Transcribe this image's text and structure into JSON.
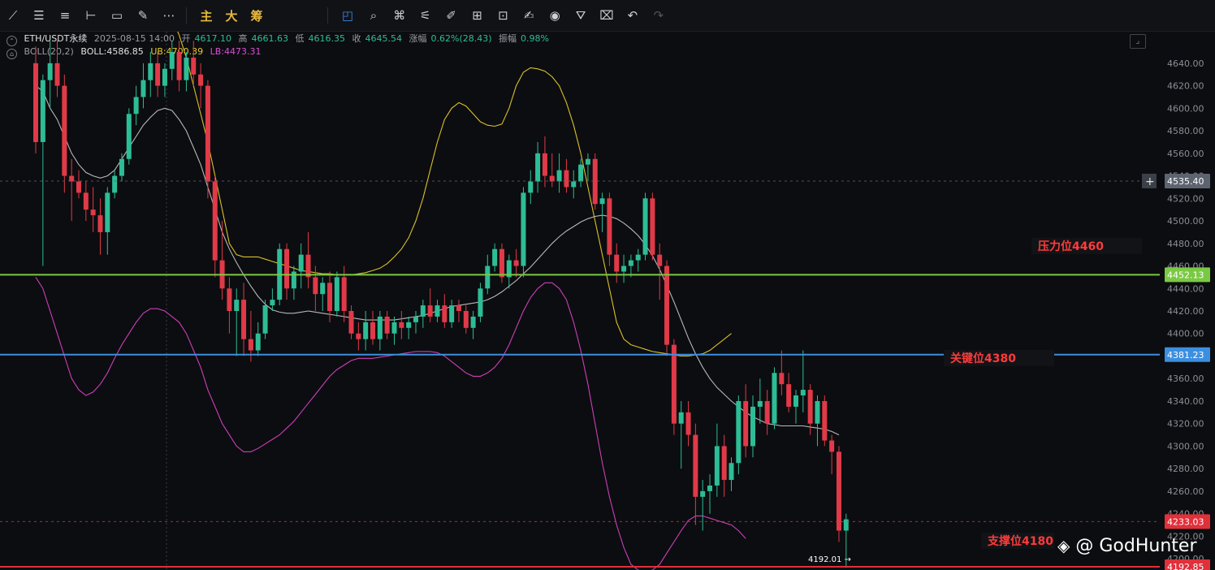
{
  "toolbar": {
    "tools": [
      "trend-line-icon",
      "horizontal-lines-icon",
      "parallel-lines-icon",
      "horizontal-ray-icon",
      "rectangle-icon",
      "brush-icon",
      "more-icon"
    ],
    "labels": [
      "主",
      "大",
      "筹"
    ],
    "right_tools": [
      "indicator-icon",
      "magic-icon",
      "shape-select-icon",
      "ruler-icon",
      "pencil-icon",
      "measure-icon",
      "lock-icon",
      "note-icon",
      "magnet-icon",
      "filter-icon",
      "trash-icon",
      "undo-icon",
      "redo-icon"
    ]
  },
  "info": {
    "symbol": "ETH/USDT永续",
    "time": "2025-08-15 14:00",
    "open_label": "开",
    "open": "4617.10",
    "high_label": "高",
    "high": "4661.63",
    "low_label": "低",
    "low": "4616.35",
    "close_label": "收",
    "close": "4645.54",
    "change_label": "涨幅",
    "change": "0.62%(28.43)",
    "amp_label": "振幅",
    "amp": "0.98%",
    "boll_name": "BOLL(20,2)",
    "boll": "BOLL:4586.85",
    "ub": "UB:4700.39",
    "lb": "LB:4473.31"
  },
  "annotations": {
    "resistance": "压力位4460",
    "key": "关键位4380",
    "support": "支撑位4180"
  },
  "watermark": "@ GodHunter",
  "chart_data": {
    "type": "candlestick",
    "symbol": "ETH/USDT永续",
    "y_ticks": [
      4640,
      4620,
      4600,
      4580,
      4560,
      4540,
      4520,
      4500,
      4480,
      4460,
      4440,
      4420,
      4400,
      4380,
      4360,
      4340,
      4320,
      4300,
      4280,
      4260,
      4240,
      4220,
      4200
    ],
    "ylim": [
      4190.0,
      4650.0
    ],
    "price_tags": [
      {
        "value": 4535.4,
        "label": "4535.40",
        "color": "#5d6470",
        "style": "crosshair"
      },
      {
        "value": 4452.13,
        "label": "4452.13",
        "color": "#7ac943",
        "style": "line"
      },
      {
        "value": 4381.23,
        "label": "4381.23",
        "color": "#3c8fe0",
        "style": "line"
      },
      {
        "value": 4233.03,
        "label": "4233.03",
        "color": "#e0303a",
        "style": "dashed"
      },
      {
        "value": 4192.85,
        "label": "4192.85",
        "color": "#e0303a",
        "style": "line"
      }
    ],
    "low_marker": "4192.01",
    "candles": [
      [
        4640,
        4655,
        4560,
        4570
      ],
      [
        4570,
        4630,
        4460,
        4625
      ],
      [
        4625,
        4660,
        4600,
        4640
      ],
      [
        4640,
        4660,
        4610,
        4620
      ],
      [
        4620,
        4630,
        4525,
        4540
      ],
      [
        4540,
        4555,
        4500,
        4535
      ],
      [
        4535,
        4545,
        4520,
        4525
      ],
      [
        4525,
        4535,
        4500,
        4510
      ],
      [
        4510,
        4530,
        4490,
        4505
      ],
      [
        4505,
        4520,
        4470,
        4490
      ],
      [
        4490,
        4530,
        4470,
        4525
      ],
      [
        4525,
        4545,
        4520,
        4540
      ],
      [
        4540,
        4560,
        4535,
        4555
      ],
      [
        4555,
        4600,
        4550,
        4595
      ],
      [
        4595,
        4620,
        4585,
        4610
      ],
      [
        4610,
        4640,
        4600,
        4625
      ],
      [
        4625,
        4650,
        4610,
        4640
      ],
      [
        4640,
        4650,
        4610,
        4620
      ],
      [
        4620,
        4640,
        4610,
        4635
      ],
      [
        4635,
        4660,
        4625,
        4650
      ],
      [
        4650,
        4660,
        4615,
        4625
      ],
      [
        4625,
        4650,
        4615,
        4645
      ],
      [
        4645,
        4660,
        4620,
        4630
      ],
      [
        4630,
        4640,
        4600,
        4620
      ],
      [
        4620,
        4625,
        4520,
        4535
      ],
      [
        4535,
        4540,
        4450,
        4465
      ],
      [
        4465,
        4500,
        4430,
        4440
      ],
      [
        4440,
        4450,
        4400,
        4420
      ],
      [
        4420,
        4440,
        4380,
        4430
      ],
      [
        4430,
        4445,
        4380,
        4395
      ],
      [
        4395,
        4420,
        4375,
        4385
      ],
      [
        4385,
        4410,
        4380,
        4400
      ],
      [
        4400,
        4430,
        4395,
        4425
      ],
      [
        4425,
        4440,
        4420,
        4430
      ],
      [
        4430,
        4480,
        4425,
        4475
      ],
      [
        4475,
        4480,
        4430,
        4440
      ],
      [
        4440,
        4460,
        4430,
        4455
      ],
      [
        4455,
        4480,
        4440,
        4470
      ],
      [
        4470,
        4490,
        4440,
        4450
      ],
      [
        4450,
        4460,
        4420,
        4435
      ],
      [
        4435,
        4450,
        4420,
        4445
      ],
      [
        4445,
        4455,
        4410,
        4420
      ],
      [
        4420,
        4455,
        4415,
        4450
      ],
      [
        4450,
        4460,
        4410,
        4420
      ],
      [
        4420,
        4425,
        4395,
        4400
      ],
      [
        4400,
        4410,
        4385,
        4395
      ],
      [
        4395,
        4420,
        4385,
        4410
      ],
      [
        4410,
        4420,
        4390,
        4395
      ],
      [
        4395,
        4420,
        4385,
        4415
      ],
      [
        4415,
        4420,
        4395,
        4400
      ],
      [
        4400,
        4415,
        4390,
        4410
      ],
      [
        4410,
        4420,
        4395,
        4405
      ],
      [
        4405,
        4415,
        4395,
        4410
      ],
      [
        4410,
        4420,
        4400,
        4415
      ],
      [
        4415,
        4430,
        4405,
        4425
      ],
      [
        4425,
        4440,
        4410,
        4415
      ],
      [
        4415,
        4430,
        4410,
        4425
      ],
      [
        4425,
        4435,
        4405,
        4410
      ],
      [
        4410,
        4430,
        4405,
        4425
      ],
      [
        4425,
        4430,
        4410,
        4420
      ],
      [
        4420,
        4425,
        4400,
        4405
      ],
      [
        4405,
        4420,
        4395,
        4415
      ],
      [
        4415,
        4445,
        4410,
        4440
      ],
      [
        4440,
        4470,
        4435,
        4460
      ],
      [
        4460,
        4480,
        4455,
        4475
      ],
      [
        4475,
        4480,
        4445,
        4450
      ],
      [
        4450,
        4470,
        4440,
        4465
      ],
      [
        4465,
        4475,
        4450,
        4460
      ],
      [
        4460,
        4530,
        4450,
        4525
      ],
      [
        4525,
        4545,
        4515,
        4535
      ],
      [
        4535,
        4570,
        4525,
        4560
      ],
      [
        4560,
        4575,
        4530,
        4540
      ],
      [
        4540,
        4560,
        4530,
        4535
      ],
      [
        4535,
        4560,
        4525,
        4545
      ],
      [
        4545,
        4555,
        4525,
        4530
      ],
      [
        4530,
        4545,
        4520,
        4535
      ],
      [
        4535,
        4555,
        4530,
        4550
      ],
      [
        4550,
        4560,
        4535,
        4555
      ],
      [
        4555,
        4560,
        4510,
        4515
      ],
      [
        4515,
        4525,
        4490,
        4520
      ],
      [
        4520,
        4525,
        4460,
        4470
      ],
      [
        4470,
        4480,
        4445,
        4455
      ],
      [
        4455,
        4470,
        4445,
        4460
      ],
      [
        4460,
        4470,
        4450,
        4465
      ],
      [
        4465,
        4475,
        4455,
        4470
      ],
      [
        4470,
        4525,
        4465,
        4520
      ],
      [
        4520,
        4525,
        4465,
        4470
      ],
      [
        4470,
        4480,
        4430,
        4460
      ],
      [
        4460,
        4465,
        4380,
        4390
      ],
      [
        4390,
        4395,
        4310,
        4320
      ],
      [
        4320,
        4340,
        4280,
        4330
      ],
      [
        4330,
        4340,
        4300,
        4310
      ],
      [
        4310,
        4320,
        4230,
        4255
      ],
      [
        4255,
        4270,
        4225,
        4260
      ],
      [
        4260,
        4275,
        4240,
        4265
      ],
      [
        4265,
        4320,
        4255,
        4300
      ],
      [
        4300,
        4310,
        4255,
        4270
      ],
      [
        4270,
        4290,
        4260,
        4285
      ],
      [
        4285,
        4345,
        4275,
        4340
      ],
      [
        4340,
        4355,
        4290,
        4300
      ],
      [
        4300,
        4345,
        4290,
        4335
      ],
      [
        4335,
        4360,
        4320,
        4340
      ],
      [
        4340,
        4350,
        4310,
        4320
      ],
      [
        4320,
        4370,
        4315,
        4365
      ],
      [
        4365,
        4385,
        4345,
        4355
      ],
      [
        4355,
        4365,
        4330,
        4335
      ],
      [
        4335,
        4350,
        4320,
        4345
      ],
      [
        4345,
        4385,
        4330,
        4350
      ],
      [
        4350,
        4355,
        4310,
        4320
      ],
      [
        4320,
        4345,
        4300,
        4340
      ],
      [
        4340,
        4345,
        4300,
        4305
      ],
      [
        4305,
        4310,
        4275,
        4295
      ],
      [
        4295,
        4300,
        4215,
        4225
      ],
      [
        4225,
        4240,
        4192.01,
        4235
      ]
    ],
    "boll_mid": [
      4620,
      4615,
      4600,
      4590,
      4575,
      4560,
      4550,
      4543,
      4540,
      4538,
      4540,
      4545,
      4555,
      4565,
      4575,
      4585,
      4592,
      4598,
      4600,
      4598,
      4590,
      4580,
      4565,
      4550,
      4530,
      4510,
      4490,
      4475,
      4463,
      4452,
      4442,
      4433,
      4426,
      4421,
      4419,
      4418,
      4418,
      4419,
      4420,
      4419,
      4418,
      4417,
      4416,
      4415,
      4414,
      4413,
      4412,
      4412,
      4412,
      4412,
      4412,
      4413,
      4414,
      4415,
      4416,
      4418,
      4420,
      4422,
      4424,
      4425,
      4426,
      4427,
      4428,
      4430,
      4433,
      4437,
      4442,
      4447,
      4453,
      4459,
      4466,
      4473,
      4480,
      4486,
      4491,
      4495,
      4499,
      4502,
      4504,
      4505,
      4504,
      4502,
      4498,
      4493,
      4487,
      4479,
      4469,
      4457,
      4443,
      4428,
      4412,
      4396,
      4382,
      4370,
      4360,
      4352,
      4346,
      4340,
      4335,
      4330,
      4326,
      4323,
      4320,
      4319,
      4318,
      4318,
      4318,
      4318,
      4317,
      4316,
      4315,
      4313,
      4310
    ],
    "boll_ub": [
      4800,
      4790,
      4770,
      4750,
      4730,
      4710,
      4700,
      4690,
      4685,
      4680,
      4680,
      4682,
      4685,
      4690,
      4695,
      4700,
      4700,
      4698,
      4690,
      4680,
      4665,
      4645,
      4620,
      4595,
      4570,
      4540,
      4510,
      4480,
      4470,
      4468,
      4468,
      4468,
      4466,
      4464,
      4462,
      4460,
      4458,
      4456,
      4455,
      4454,
      4453,
      4453,
      4452,
      4452,
      4452,
      4453,
      4454,
      4456,
      4458,
      4462,
      4468,
      4475,
      4485,
      4500,
      4520,
      4545,
      4570,
      4590,
      4600,
      4605,
      4602,
      4595,
      4588,
      4585,
      4584,
      4586,
      4600,
      4620,
      4632,
      4636,
      4635,
      4633,
      4628,
      4620,
      4605,
      4585,
      4560,
      4530,
      4500,
      4470,
      4440,
      4410,
      4395,
      4390,
      4388,
      4386,
      4384,
      4383,
      4382,
      4381,
      4380,
      4380,
      4381,
      4382,
      4385,
      4390,
      4395,
      4400
    ],
    "boll_lb": [
      4450,
      4440,
      4420,
      4400,
      4380,
      4360,
      4350,
      4345,
      4348,
      4355,
      4365,
      4378,
      4390,
      4400,
      4410,
      4418,
      4422,
      4422,
      4420,
      4415,
      4410,
      4400,
      4385,
      4370,
      4350,
      4335,
      4320,
      4310,
      4300,
      4295,
      4295,
      4298,
      4302,
      4306,
      4310,
      4316,
      4322,
      4330,
      4338,
      4346,
      4354,
      4362,
      4368,
      4372,
      4376,
      4378,
      4378,
      4378,
      4379,
      4380,
      4381,
      4382,
      4383,
      4384,
      4384,
      4384,
      4383,
      4380,
      4375,
      4370,
      4365,
      4362,
      4362,
      4365,
      4370,
      4378,
      4390,
      4405,
      4420,
      4432,
      4440,
      4445,
      4445,
      4440,
      4430,
      4410,
      4385,
      4355,
      4320,
      4285,
      4255,
      4230,
      4210,
      4195,
      4190,
      4188,
      4190,
      4195,
      4205,
      4215,
      4225,
      4234,
      4238,
      4238,
      4236,
      4234,
      4232,
      4230,
      4225,
      4218
    ]
  }
}
